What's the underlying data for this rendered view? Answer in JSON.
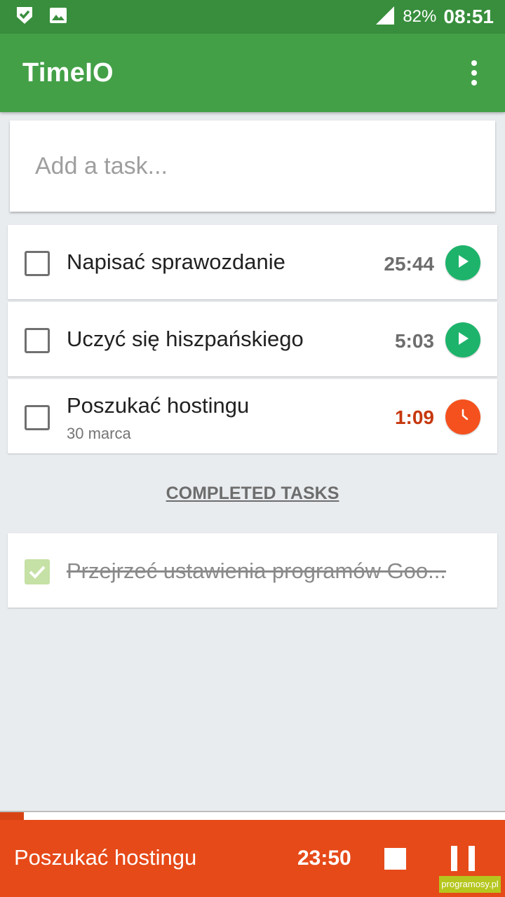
{
  "status_bar": {
    "battery": "82%",
    "time": "08:51"
  },
  "app_bar": {
    "title": "TimeIO"
  },
  "add_task": {
    "placeholder": "Add a task..."
  },
  "tasks": [
    {
      "title": "Napisać sprawozdanie",
      "time": "25:44",
      "button": "play",
      "subtitle": ""
    },
    {
      "title": "Uczyć się hiszpańskiego",
      "time": "5:03",
      "button": "play",
      "subtitle": ""
    },
    {
      "title": "Poszukać hostingu",
      "time": "1:09",
      "button": "timer",
      "subtitle": "30 marca"
    }
  ],
  "completed": {
    "header": "COMPLETED TASKS",
    "items": [
      {
        "title": "Przejrzeć ustawienia programów Goo..."
      }
    ]
  },
  "timer_bar": {
    "task": "Poszukać hostingu",
    "time": "23:50",
    "progress": 0.047
  },
  "watermark": "programosy.pl",
  "colors": {
    "primary": "#43a047",
    "primary_dark": "#388e3c",
    "accent_play": "#1db36b",
    "accent_active": "#f4511e",
    "timer_bar": "#e64a19"
  }
}
